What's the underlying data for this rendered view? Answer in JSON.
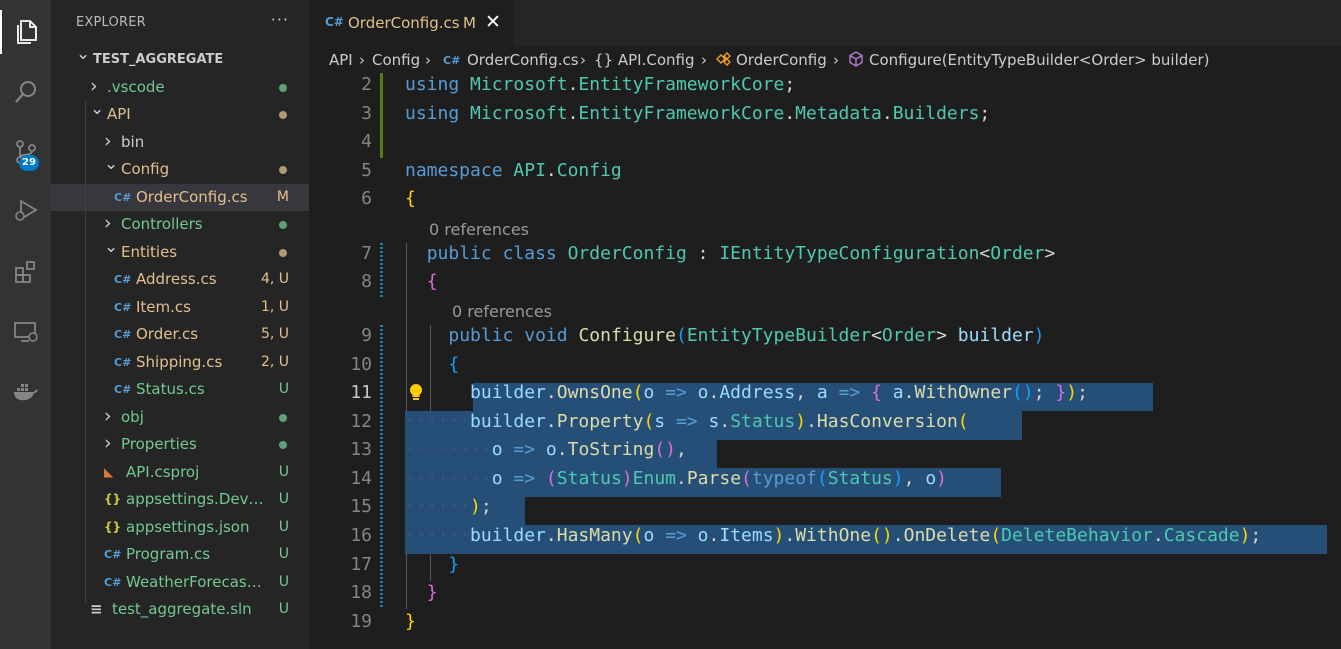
{
  "explorer": {
    "title": "EXPLORER",
    "more": "···",
    "rows": [
      {
        "label": "TEST_AGGREGATE",
        "kind": "root",
        "depth": 0,
        "chevron": "down",
        "color": "#cccccc",
        "deco": "",
        "dot": ""
      },
      {
        "label": ".vscode",
        "kind": "folder",
        "depth": 1,
        "chevron": "right",
        "color": "#73c991",
        "deco": "",
        "dot": "#73c991"
      },
      {
        "label": "API",
        "kind": "folder",
        "depth": 1,
        "chevron": "down",
        "color": "#e2c08d",
        "deco": "",
        "dot": "#e2c08d"
      },
      {
        "label": "bin",
        "kind": "folder",
        "depth": 2,
        "chevron": "right",
        "color": "#cccccc",
        "deco": "",
        "dot": ""
      },
      {
        "label": "Config",
        "kind": "folder",
        "depth": 2,
        "chevron": "down",
        "color": "#e2c08d",
        "deco": "",
        "dot": "#e2c08d"
      },
      {
        "label": "OrderConfig.cs",
        "kind": "cs",
        "depth": 3,
        "chevron": "",
        "color": "#e2c08d",
        "deco": "M",
        "dot": "",
        "selected": true
      },
      {
        "label": "Controllers",
        "kind": "folder",
        "depth": 2,
        "chevron": "right",
        "color": "#73c991",
        "deco": "",
        "dot": "#73c991"
      },
      {
        "label": "Entities",
        "kind": "folder",
        "depth": 2,
        "chevron": "down",
        "color": "#e2c08d",
        "deco": "",
        "dot": "#e2c08d"
      },
      {
        "label": "Address.cs",
        "kind": "cs",
        "depth": 3,
        "chevron": "",
        "color": "#e2c08d",
        "deco": "4, U",
        "dot": ""
      },
      {
        "label": "Item.cs",
        "kind": "cs",
        "depth": 3,
        "chevron": "",
        "color": "#e2c08d",
        "deco": "1, U",
        "dot": ""
      },
      {
        "label": "Order.cs",
        "kind": "cs",
        "depth": 3,
        "chevron": "",
        "color": "#e2c08d",
        "deco": "5, U",
        "dot": ""
      },
      {
        "label": "Shipping.cs",
        "kind": "cs",
        "depth": 3,
        "chevron": "",
        "color": "#e2c08d",
        "deco": "2, U",
        "dot": ""
      },
      {
        "label": "Status.cs",
        "kind": "cs",
        "depth": 3,
        "chevron": "",
        "color": "#73c991",
        "deco": "U",
        "dot": ""
      },
      {
        "label": "obj",
        "kind": "folder",
        "depth": 2,
        "chevron": "right",
        "color": "#73c991",
        "deco": "",
        "dot": "#73c991"
      },
      {
        "label": "Properties",
        "kind": "folder",
        "depth": 2,
        "chevron": "right",
        "color": "#73c991",
        "deco": "",
        "dot": "#73c991"
      },
      {
        "label": "API.csproj",
        "kind": "rss",
        "depth": 2,
        "chevron": "",
        "color": "#73c991",
        "deco": "U",
        "dot": ""
      },
      {
        "label": "appsettings.Develop...",
        "kind": "json",
        "depth": 2,
        "chevron": "",
        "color": "#73c991",
        "deco": "U",
        "dot": ""
      },
      {
        "label": "appsettings.json",
        "kind": "json",
        "depth": 2,
        "chevron": "",
        "color": "#73c991",
        "deco": "U",
        "dot": ""
      },
      {
        "label": "Program.cs",
        "kind": "cs",
        "depth": 2,
        "chevron": "",
        "color": "#73c991",
        "deco": "U",
        "dot": ""
      },
      {
        "label": "WeatherForecast.cs",
        "kind": "cs",
        "depth": 2,
        "chevron": "",
        "color": "#73c991",
        "deco": "U",
        "dot": ""
      },
      {
        "label": "test_aggregate.sln",
        "kind": "sln",
        "depth": 1,
        "chevron": "",
        "color": "#73c991",
        "deco": "U",
        "dot": ""
      }
    ]
  },
  "activity": {
    "scm_badge": "29"
  },
  "tab": {
    "name": "OrderConfig.cs",
    "modified": "M",
    "close": "✕",
    "icon": "C#"
  },
  "breadcrumbs": {
    "api": "API",
    "config": "Config",
    "file": "OrderConfig.cs",
    "namespace": "{} API.Config",
    "klass": "OrderConfig",
    "method": "Configure(EntityTypeBuilder<Order> builder)",
    "sep": "›"
  },
  "editor": {
    "line_numbers": [
      "2",
      "3",
      "4",
      "5",
      "6",
      "7",
      "8",
      "9",
      "10",
      "11",
      "12",
      "13",
      "14",
      "15",
      "16",
      "17",
      "18",
      "19"
    ],
    "codelens_class": "0 references",
    "codelens_method": "0 references",
    "code": [
      "using Microsoft.EntityFrameworkCore;",
      "using Microsoft.EntityFrameworkCore.Metadata.Builders;",
      "",
      "namespace API.Config",
      "{",
      "  public class OrderConfig : IEntityTypeConfiguration<Order>",
      "  {",
      "    public void Configure(EntityTypeBuilder<Order> builder)",
      "    {",
      "      builder.OwnsOne(o => o.Address, a => { a.WithOwner(); });",
      "      builder.Property(s => s.Status).HasConversion(",
      "        o => o.ToString(),",
      "        o => (Status)Enum.Parse(typeof(Status), o)",
      "      );",
      "      builder.HasMany(o => o.Items).WithOne().OnDelete(DeleteBehavior.Cascade);",
      "    }",
      "  }",
      "}"
    ]
  },
  "colors": {
    "modified": "#e2c08d",
    "untracked": "#73c991",
    "selection": "#264f78",
    "accent": "#007acc"
  }
}
